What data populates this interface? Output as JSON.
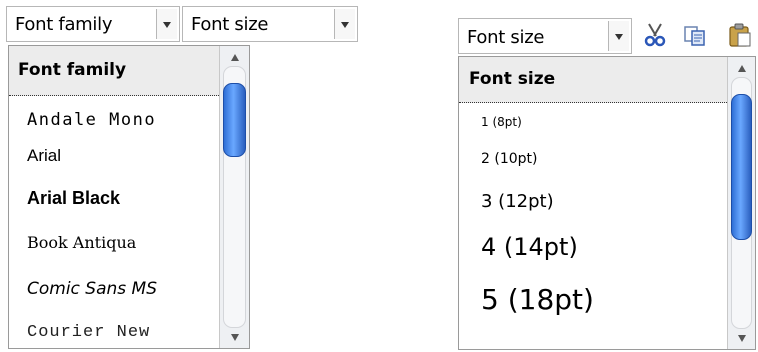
{
  "font_family_select": {
    "label": "Font family"
  },
  "font_size_select": {
    "label": "Font size"
  },
  "font_family_menu": {
    "header": "Font family",
    "items": [
      "Andale Mono",
      "Arial",
      "Arial Black",
      "Book Antiqua",
      "Comic Sans MS",
      "Courier New"
    ]
  },
  "font_size_menu": {
    "select_label": "Font size",
    "header": "Font size",
    "items": [
      "1 (8pt)",
      "2 (10pt)",
      "3 (12pt)",
      "4 (14pt)",
      "5 (18pt)"
    ]
  },
  "toolbar_icons": [
    "cut-icon",
    "copy-icon",
    "paste-icon"
  ],
  "colors": {
    "scroll_thumb": "#3b7be0",
    "header_bg": "#ececec"
  }
}
